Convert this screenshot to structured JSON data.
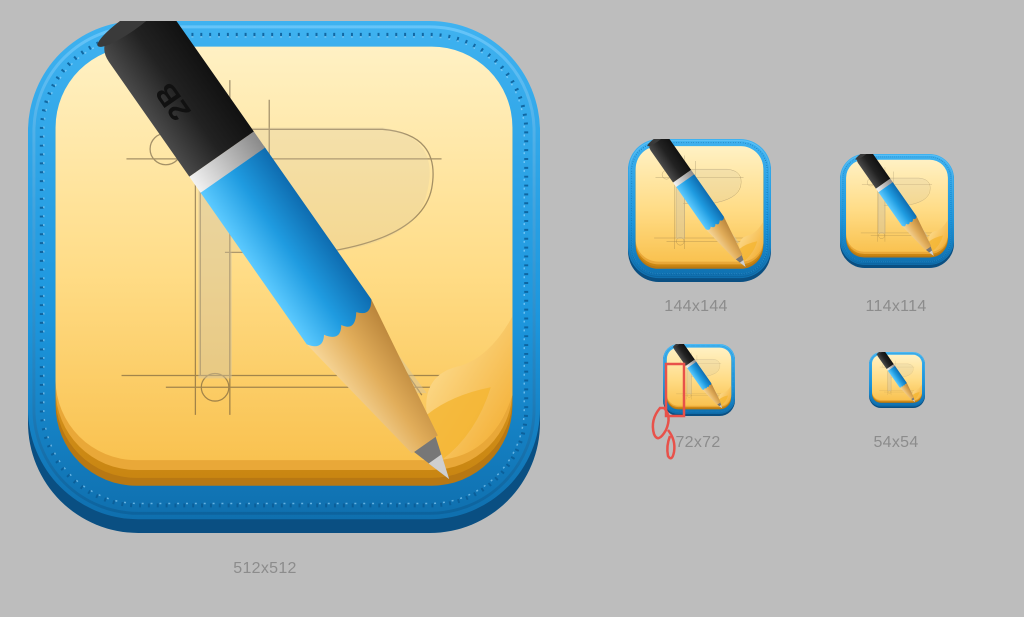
{
  "pencil_grade": "2B",
  "icons": [
    {
      "id": "512",
      "label": "512x512"
    },
    {
      "id": "144",
      "label": "144x144"
    },
    {
      "id": "114",
      "label": "114x114"
    },
    {
      "id": "72",
      "label": "72x72"
    },
    {
      "id": "54",
      "label": "54x54"
    }
  ],
  "colors": {
    "background": "#bdbdbd",
    "frame_blue": "#1f9be0",
    "paper_yellow": "#fcd46a",
    "pencil_body": "#2c2c2c",
    "pencil_ferrule_blue": "#29a3ea",
    "label_gray": "#8c8c8c",
    "annotation_red": "#e8514a"
  },
  "icon_name": "pencil-sketch-app-icon"
}
